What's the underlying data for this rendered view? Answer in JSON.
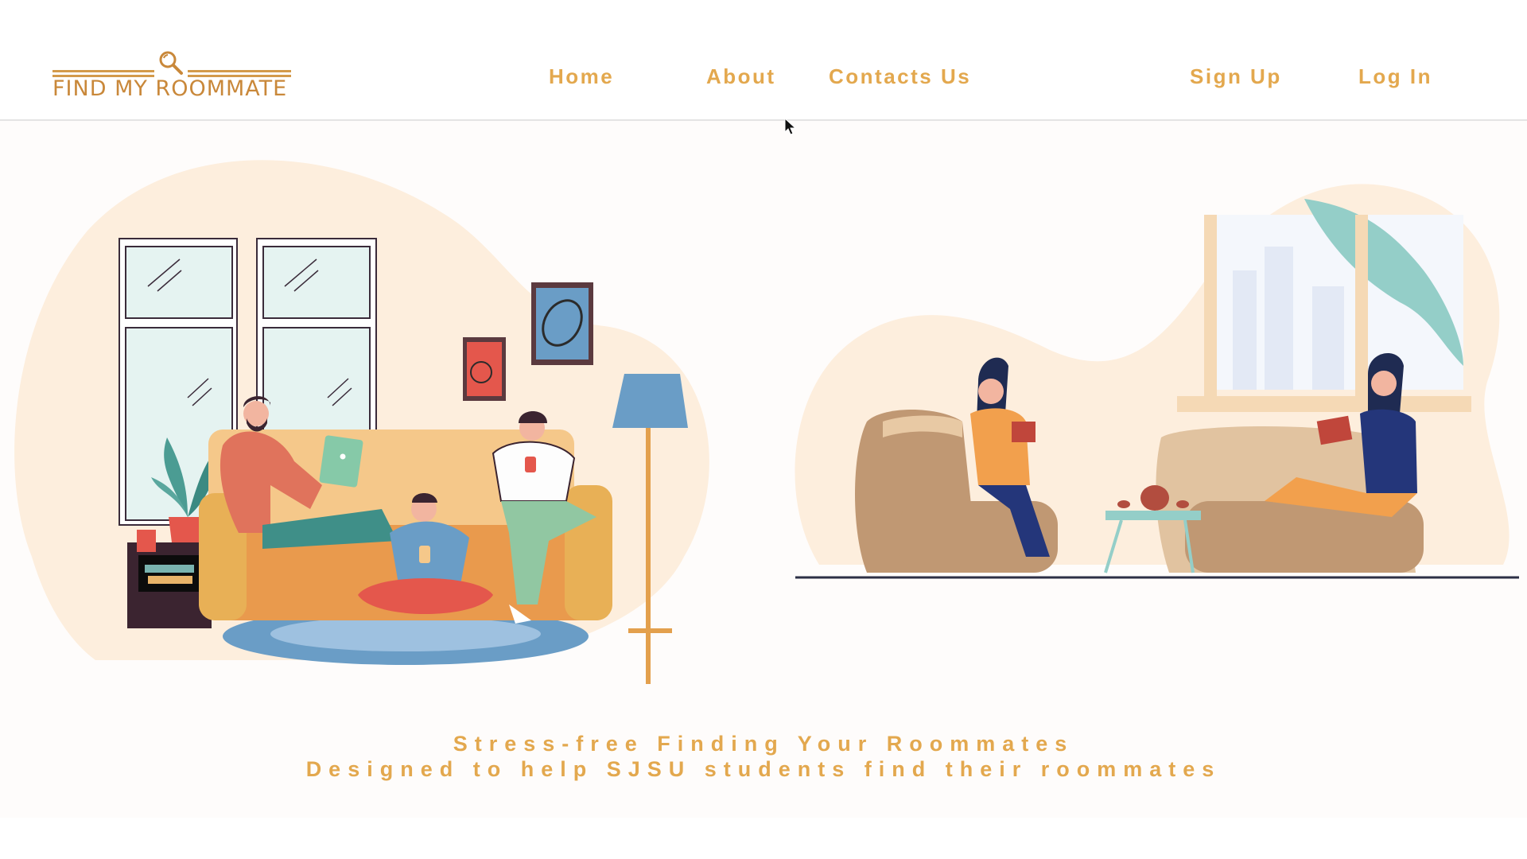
{
  "brand": {
    "name": "FIND MY ROOMMATE",
    "accent": "#e3a84e",
    "logo_color": "#c9883a"
  },
  "nav": {
    "home": "Home",
    "about": "About",
    "contacts": "Contacts Us",
    "signup": "Sign Up",
    "login": "Log In"
  },
  "hero": {
    "headline": "Stress-free Finding Your Roommates",
    "subheadline": "Designed to help SJSU students find their roommates",
    "left_illustration": "roommates-living-room-illustration",
    "right_illustration": "women-reading-lounge-illustration"
  },
  "icons": {
    "logo": "magnifier-icon",
    "cursor": "mouse-pointer-icon"
  }
}
